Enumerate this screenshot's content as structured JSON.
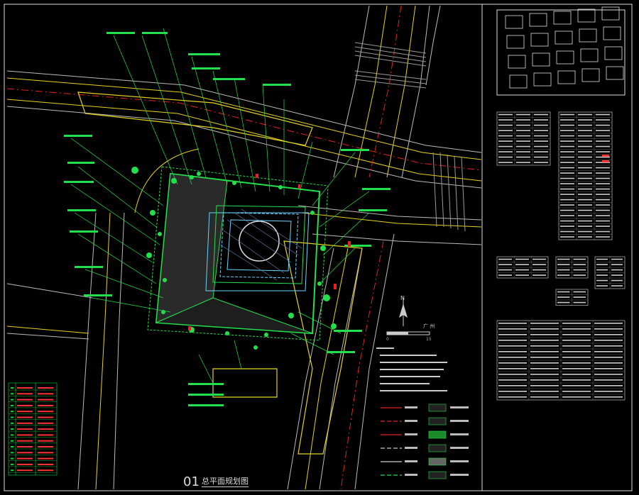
{
  "drawing": {
    "sheet_number": "01",
    "sheet_title": "总平面规划图",
    "north_label": "N",
    "plaza_label": "广 州",
    "scale_marks": [
      "0",
      "15"
    ]
  },
  "colors": {
    "background": "#000000",
    "plan_green": "#22e04a",
    "road_yellow": "#e6d21c",
    "centerline_red": "#e02222",
    "frame_white": "#e8e8e8",
    "table_red": "#ff3333",
    "table_green": "#00dd33"
  }
}
